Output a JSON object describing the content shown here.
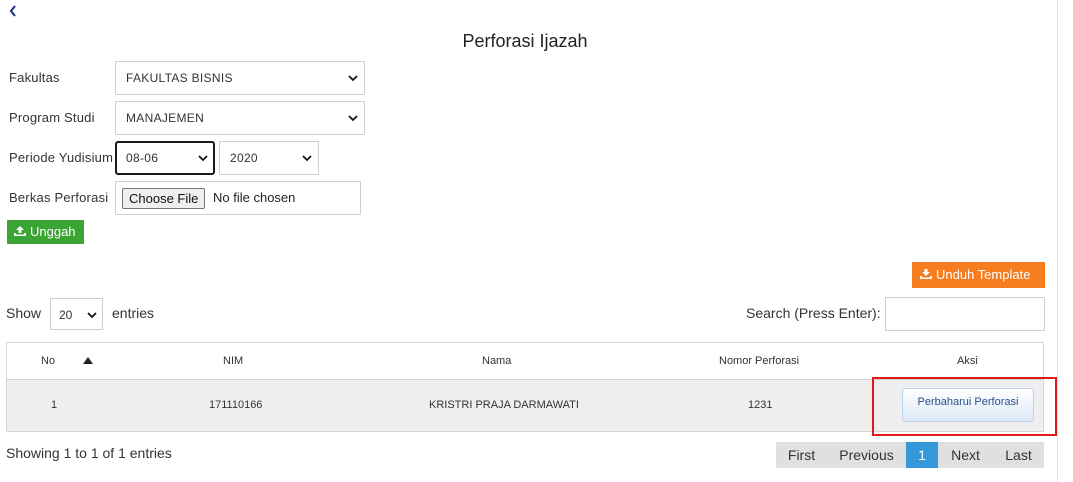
{
  "header": {
    "back_label": "‹",
    "title": "Perforasi Ijazah"
  },
  "form": {
    "fakultas": {
      "label": "Fakultas",
      "value": "FAKULTAS BISNIS"
    },
    "prodi": {
      "label": "Program Studi",
      "value": "MANAJEMEN"
    },
    "periode": {
      "label": "Periode Yudisium",
      "value": "08-06",
      "year": "2020"
    },
    "berkas": {
      "label": "Berkas Perforasi",
      "button": "Choose File",
      "status": "No file chosen"
    },
    "upload_button": "Unggah"
  },
  "toolbar": {
    "template_button": "Unduh Template"
  },
  "table_controls": {
    "show_label": "Show",
    "entries_value": "20",
    "entries_label": "entries",
    "search_label": "Search (Press Enter):",
    "search_value": ""
  },
  "table": {
    "headers": [
      "No",
      "NIM",
      "Nama",
      "Nomor Perforasi",
      "Aksi"
    ],
    "rows": [
      {
        "no": "1",
        "nim": "171110166",
        "nama": "KRISTRI PRAJA DARMAWATI",
        "nomor": "1231",
        "action": "Perbaharui Perforasi"
      }
    ]
  },
  "footer": {
    "info": "Showing 1 to 1 of 1 entries",
    "pagination": {
      "first": "First",
      "previous": "Previous",
      "current": "1",
      "next": "Next",
      "last": "Last"
    }
  },
  "colors": {
    "upload_button": "#3aa532",
    "template_button": "#f57c1f",
    "active_page": "#3498db",
    "highlight_box": "#e01b1b"
  },
  "icons": {
    "back": "chevron-left-icon",
    "select_arrow": "chevron-down-icon",
    "upload": "upload-tray-icon",
    "download": "download-tray-icon",
    "sort": "sort-up-icon"
  }
}
